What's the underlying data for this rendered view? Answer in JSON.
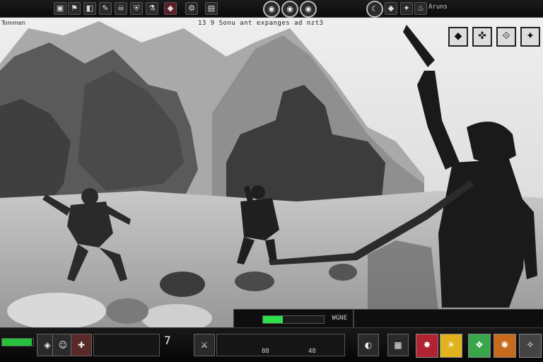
{
  "hud": {
    "topbar": {
      "left_icons": [
        "bag-icon",
        "flag-icon",
        "map-icon",
        "scroll-icon",
        "skull-icon",
        "shield-icon",
        "potion-icon",
        "cog-icon"
      ],
      "compass_icons": [
        "eye-icon",
        "eye-icon",
        "eye-icon"
      ],
      "right_icons": [
        "moon-icon",
        "diamond-icon",
        "gem-icon",
        "flame-icon"
      ],
      "right_text": "Aruns"
    },
    "subtitle": "13  9  Sonu ant expanges ad nzt3",
    "corner_label": "Tommen",
    "runes": [
      "◆",
      "✜",
      "⟐",
      "✦"
    ],
    "center_meter_value": 0.32,
    "center_meter_text": "WGNE",
    "hp_value": 0.95,
    "bottom_text_1": "7",
    "bottom_text_2": "88",
    "bottom_text_3": "48"
  },
  "colors": {
    "hp": "#27c13d",
    "slot_red": "#b02330",
    "slot_yellow": "#e2b21d",
    "slot_orange": "#c76a1c",
    "slot_green": "#3aa64c"
  }
}
